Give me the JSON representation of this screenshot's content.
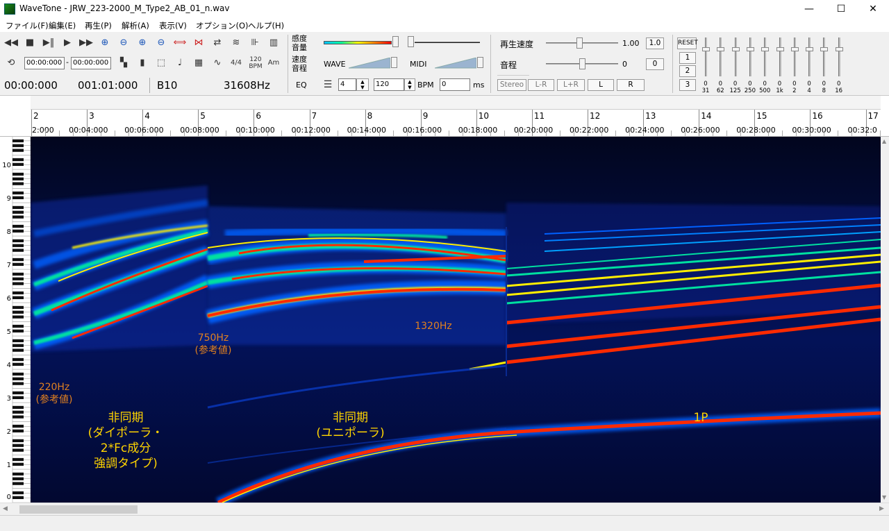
{
  "window": {
    "title": "WaveTone - JRW_223-2000_M_Type2_AB_01_n.wav",
    "minimize": "—",
    "maximize": "☐",
    "close": "✕"
  },
  "menu": [
    "ファイル(F)",
    "編集(E)",
    "再生(P)",
    "解析(A)",
    "表示(V)",
    "オプション(O)",
    "ヘルプ(H)"
  ],
  "toolbar": {
    "range_start": "00:00:000",
    "range_sep": "-",
    "range_end": "00:00:000",
    "time_sig": "4/4",
    "bpm_icon": "120 BPM",
    "am": "Am",
    "position": "00:00:000",
    "duration": "001:01:000",
    "note": "B10",
    "freq": "31608Hz",
    "sensitivity": "感度",
    "volume": "音量",
    "speed": "速度",
    "pitch": "音程",
    "eq": "EQ",
    "wave": "WAVE",
    "midi": "MIDI",
    "beat_val": "4",
    "bpm_val": "120",
    "bpm_label": "BPM",
    "ms_val": "0",
    "ms_label": "ms",
    "play_speed_label": "再生速度",
    "play_speed_val": "1.00",
    "play_speed_btn": "1.0",
    "pitch_label": "音程",
    "pitch_val": "0",
    "pitch_btn": "0",
    "stereo": "Stereo",
    "lr_minus": "L-R",
    "lr_plus": "L+R",
    "l": "L",
    "r": "R",
    "reset": "RESET",
    "preset1": "1",
    "preset2": "2",
    "preset3": "3",
    "eq_bands": [
      "0",
      "0",
      "0",
      "0",
      "0",
      "0",
      "0",
      "0",
      "0",
      "0"
    ],
    "eq_freqs": [
      "31",
      "62",
      "125",
      "250",
      "500",
      "1k",
      "2",
      "4",
      "8",
      "16"
    ]
  },
  "ruler": {
    "numbers": [
      "2",
      "3",
      "4",
      "5",
      "6",
      "7",
      "8",
      "9",
      "10",
      "11",
      "12",
      "13",
      "14",
      "15",
      "16",
      "17"
    ],
    "times": [
      "2:000",
      "00:04:000",
      "00:06:000",
      "00:08:000",
      "00:10:000",
      "00:12:000",
      "00:14:000",
      "00:16:000",
      "00:18:000",
      "00:20:000",
      "00:22:000",
      "00:24:000",
      "00:26:000",
      "00:28:000",
      "00:30:000",
      "00:32:0"
    ]
  },
  "octaves": [
    "10",
    "9",
    "8",
    "7",
    "6",
    "5",
    "4",
    "3",
    "2",
    "1",
    "0"
  ],
  "annotations": {
    "hz220": "220Hz",
    "ref1": "(参考値)",
    "hz750": "750Hz",
    "ref2": "(参考値)",
    "hz1320": "1320Hz",
    "async1_l1": "非同期",
    "async1_l2": "(ダイポーラ・",
    "async1_l3": "2*Fc成分",
    "async1_l4": "強調タイプ)",
    "async2_l1": "非同期",
    "async2_l2": "(ユニポーラ)",
    "sync1p": "1P"
  },
  "colors": {
    "spectro_bg": "#000320",
    "hot": "#ff2a00",
    "warm": "#ffee00",
    "mid": "#00e0a0",
    "cool": "#1060ff",
    "annotation_orange": "#e08020",
    "annotation_yellow": "#ffd400"
  }
}
